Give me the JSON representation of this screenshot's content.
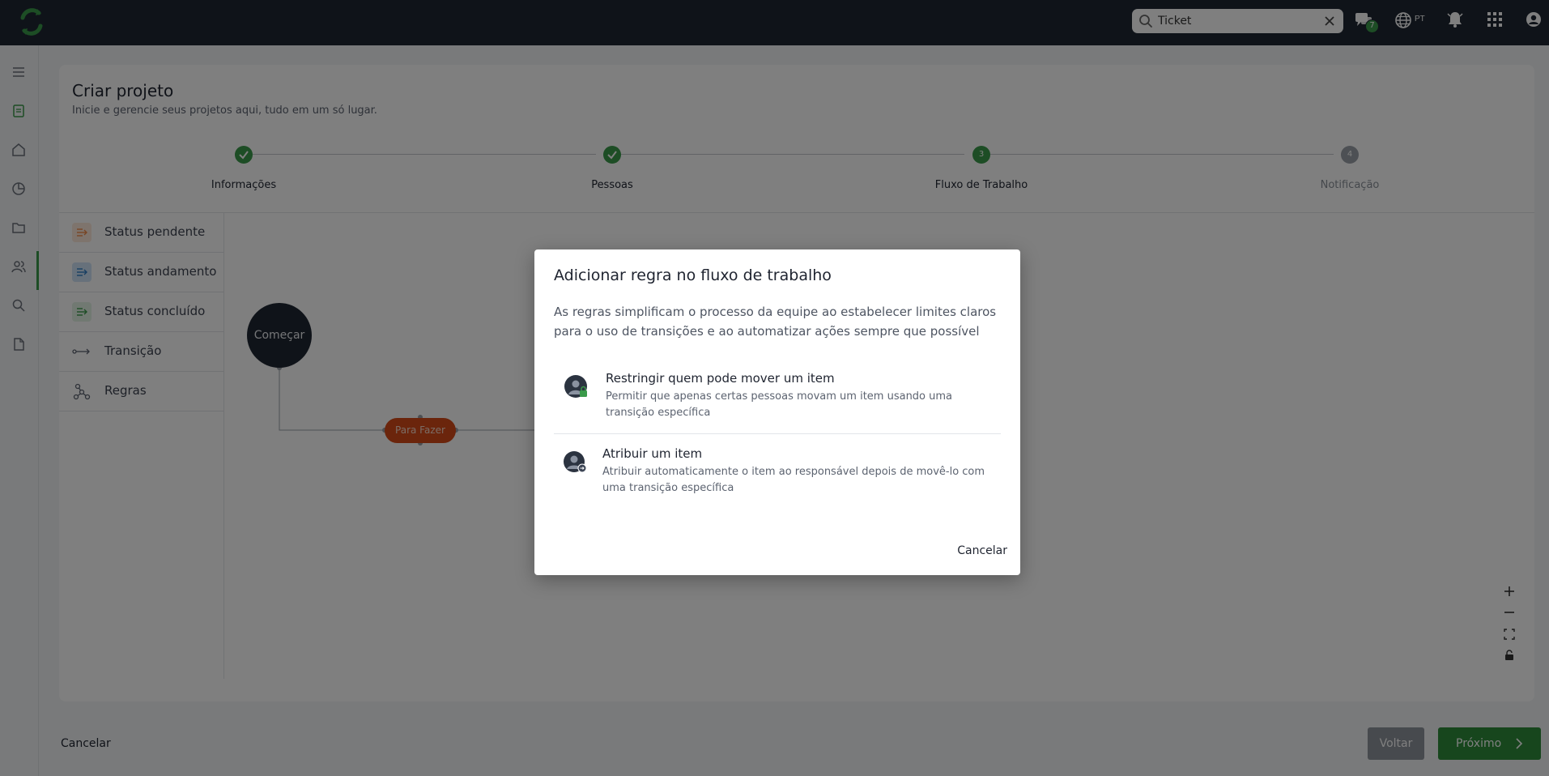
{
  "topbar": {
    "search": {
      "value": "Ticket",
      "placeholder": ""
    },
    "chat_badge": "7",
    "language": "PT",
    "icons": [
      "logo-icon",
      "search-icon",
      "clear-icon",
      "chat-icon",
      "globe-icon",
      "bell-icon",
      "apps-grid-icon",
      "user-icon"
    ]
  },
  "rail": {
    "icons": [
      "menu-icon",
      "document-icon",
      "home-icon",
      "chart-icon",
      "folder-icon",
      "users-icon",
      "search-icon",
      "file-icon"
    ]
  },
  "page": {
    "title": "Criar projeto",
    "subtitle": "Inicie e gerencie seus projetos aqui, tudo em um só lugar."
  },
  "stepper": {
    "steps": [
      {
        "label": "Informações",
        "state": "done",
        "number": ""
      },
      {
        "label": "Pessoas",
        "state": "done",
        "number": ""
      },
      {
        "label": "Fluxo de Trabalho",
        "state": "current",
        "number": "3"
      },
      {
        "label": "Notificação",
        "state": "upcoming",
        "number": "4"
      }
    ]
  },
  "panel": {
    "items": [
      {
        "label": "Status pendente",
        "color": "#f5a46b"
      },
      {
        "label": "Status andamento",
        "color": "#3d8fd6"
      },
      {
        "label": "Status concluído",
        "color": "#3a9a4a"
      },
      {
        "label": "Transição",
        "color": "#5c6370"
      },
      {
        "label": "Regras",
        "color": "#5c6370"
      }
    ]
  },
  "canvas": {
    "start_node": "Começar",
    "todo_node": "Para Fazer"
  },
  "footer": {
    "cancel": "Cancelar",
    "back": "Voltar",
    "next": "Próximo"
  },
  "modal": {
    "title": "Adicionar regra no fluxo de trabalho",
    "description": "As regras simplificam o processo da equipe ao estabelecer limites claros para o uso de transições e ao automatizar ações sempre que possível",
    "options": [
      {
        "title": "Restringir quem pode mover um item",
        "description": "Permitir que apenas certas pessoas movam um item usando uma transição específica"
      },
      {
        "title": "Atribuir um item",
        "description": "Atribuir automaticamente o item ao responsável depois de movê-lo com uma transição específica"
      }
    ],
    "cancel": "Cancelar"
  },
  "colors": {
    "topbar": "#1e2632",
    "accent_green": "#3a9a4a",
    "start_node": "#1e2632",
    "todo_node": "#d64b18"
  }
}
